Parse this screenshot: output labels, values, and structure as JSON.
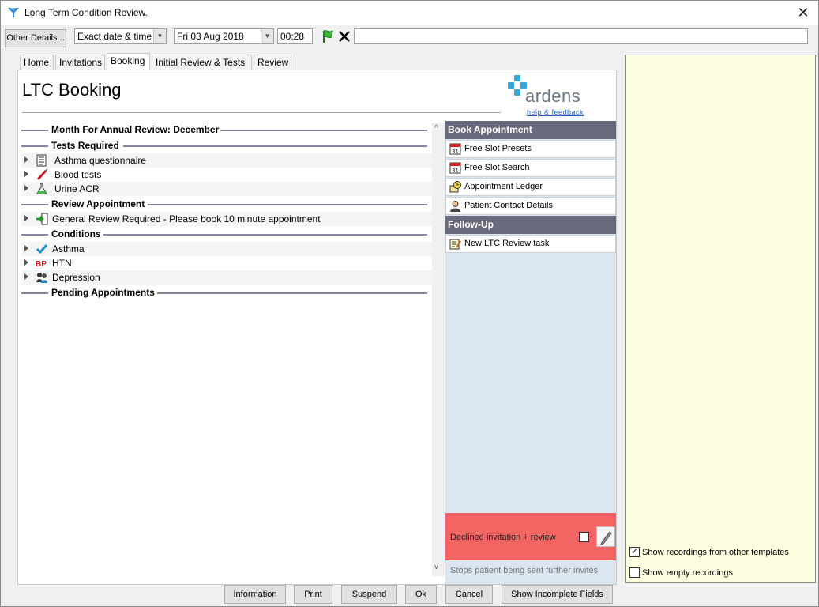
{
  "window": {
    "title": "Long Term Condition Review.",
    "close_symbol": "✕"
  },
  "toolbar": {
    "other_details_label": "Other Details...",
    "date_mode": "Exact date & time",
    "date_value": "Fri 03 Aug 2018",
    "time_value": "00:28",
    "accept_icon": "green-flag-icon",
    "clear_icon": "x-icon",
    "text_field_value": ""
  },
  "tabs": [
    {
      "label": "Home",
      "active": false
    },
    {
      "label": "Invitations",
      "active": false
    },
    {
      "label": "Booking",
      "active": true
    },
    {
      "label": "Initial Review & Tests",
      "active": false
    },
    {
      "label": "Review",
      "active": false
    }
  ],
  "page": {
    "title": "LTC Booking",
    "logo_text": "ardens",
    "logo_link": "help & feedback",
    "brand_color": "#3ba3d8"
  },
  "sections": {
    "annual_review": "Month For Annual Review: December",
    "tests_required": "Tests Required",
    "review_appointment": "Review Appointment",
    "conditions": "Conditions",
    "pending_appointments": "Pending Appointments"
  },
  "tests": [
    {
      "label": "Asthma questionnaire",
      "icon": "questionnaire-icon"
    },
    {
      "label": "Blood tests",
      "icon": "syringe-icon"
    },
    {
      "label": "Urine ACR",
      "icon": "flask-icon"
    }
  ],
  "review_items": [
    {
      "label": "General Review Required - Please book 10 minute appointment",
      "icon": "exit-door-icon"
    }
  ],
  "conditions": [
    {
      "label": "Asthma",
      "icon": "checkmark-icon"
    },
    {
      "label": "HTN",
      "icon": "bp-icon",
      "icon_text": "BP"
    },
    {
      "label": "Depression",
      "icon": "people-icon"
    }
  ],
  "sidebar": {
    "book_head": "Book Appointment",
    "book_items": [
      {
        "label": "Free Slot Presets",
        "icon": "calendar-icon"
      },
      {
        "label": "Free Slot Search",
        "icon": "calendar-icon"
      },
      {
        "label": "Appointment Ledger",
        "icon": "clock-ledger-icon"
      },
      {
        "label": "Patient Contact Details",
        "icon": "contact-icon"
      }
    ],
    "followup_head": "Follow-Up",
    "followup_items": [
      {
        "label": "New LTC Review task",
        "icon": "task-icon"
      }
    ],
    "calendar_day": "31",
    "declined_label": "Declined invitation + review",
    "declined_checked": false,
    "stops_note": "Stops patient being sent further invites"
  },
  "recordings": {
    "show_other_templates": "Show recordings from other templates",
    "show_other_templates_checked": true,
    "show_empty": "Show empty recordings",
    "show_empty_checked": false,
    "check_mark": "✓"
  },
  "buttons": {
    "information": "Information",
    "print": "Print",
    "suspend": "Suspend",
    "ok": "Ok",
    "cancel": "Cancel",
    "show_incomplete": "Show Incomplete Fields"
  }
}
